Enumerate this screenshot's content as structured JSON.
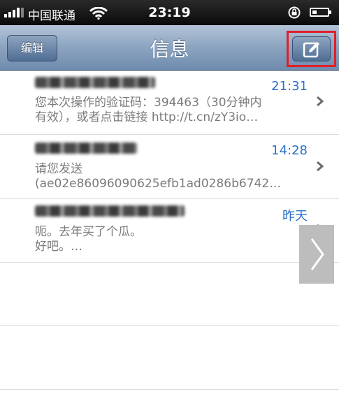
{
  "status_bar": {
    "carrier": "中国联通",
    "time": "23:19"
  },
  "nav": {
    "title": "信息",
    "edit_label": "编辑",
    "compose_icon": "compose-icon"
  },
  "messages": [
    {
      "sender": "",
      "time": "21:31",
      "preview_line1": "您本次操作的验证码：394463（30分钟内",
      "preview_line2": "有效），或者点击链接 http://t.cn/zY3io…"
    },
    {
      "sender": "",
      "time": "14:28",
      "preview_line1": "请您发送",
      "preview_line2": "(ae02e86096090625efb1ad0286b6742…"
    },
    {
      "sender": "",
      "time": "昨天",
      "preview_line1": "呃。去年买了个瓜。",
      "preview_line2": "好吧。…"
    }
  ],
  "colors": {
    "time_blue": "#2a6fc9",
    "nav_blue": "#8fa6c2",
    "highlight_red": "#e11e2a"
  }
}
